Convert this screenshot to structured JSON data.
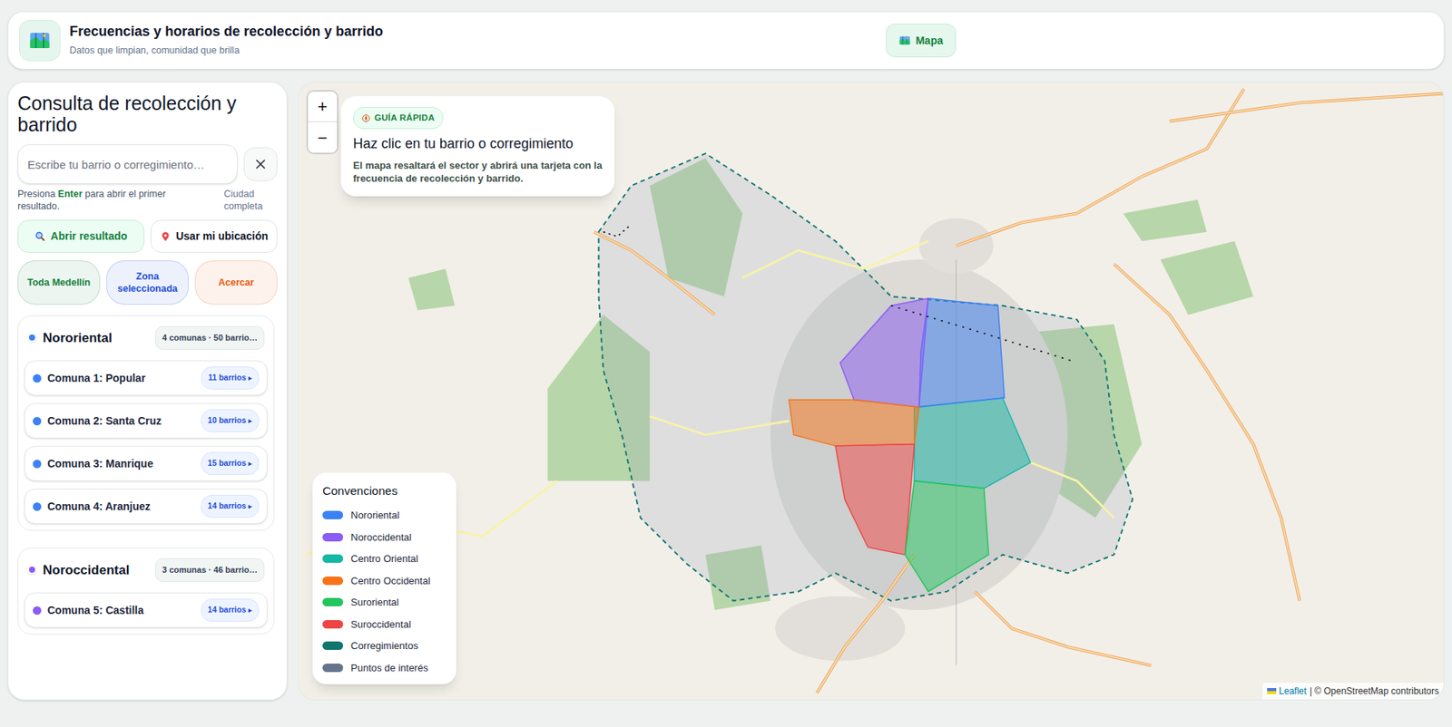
{
  "header": {
    "title": "Frecuencias y horarios de recolección y barrido",
    "subtitle": "Datos que limpian, comunidad que brilla",
    "nav": [
      {
        "label": "Mapa",
        "selected": true
      }
    ]
  },
  "sidebar": {
    "title": "Consulta de recolección y barrido",
    "search": {
      "placeholder": "Escribe tu barrio o corregimiento…",
      "value": ""
    },
    "hint": {
      "before": "Presiona ",
      "key": "Enter",
      "after": " para abrir el primer resultado."
    },
    "scope": "Ciudad completa",
    "actions": [
      "Abrir resultado",
      "Usar mi ubicación"
    ],
    "filters": [
      {
        "label": "Toda Medellín",
        "color": "#15803d"
      },
      {
        "label": "Zona seleccionada",
        "color": "#1d4ed8"
      },
      {
        "label": "Acercar",
        "color": "#ea580c"
      }
    ],
    "zones": [
      {
        "name": "Nororiental",
        "summary": "4 comunas · 50 barrio…",
        "color": "#3b82f6",
        "comunas": [
          {
            "name": "Comuna 1: Popular",
            "count": "11 barrios",
            "arrow": "▸"
          },
          {
            "name": "Comuna 2: Santa Cruz",
            "count": "10 barrios",
            "arrow": "▸"
          },
          {
            "name": "Comuna 3: Manrique",
            "count": "15 barrios",
            "arrow": "▸"
          },
          {
            "name": "Comuna 4: Aranjuez",
            "count": "14 barrios",
            "arrow": "▸"
          }
        ]
      },
      {
        "name": "Noroccidental",
        "summary": "3 comunas · 46 barrio…",
        "color": "#8b5cf6",
        "comunas": [
          {
            "name": "Comuna 5: Castilla",
            "count": "14 barrios",
            "arrow": "▸"
          }
        ]
      }
    ]
  },
  "map": {
    "zoom": [
      "+",
      "−"
    ],
    "guide": {
      "badge": "GUÍA RÁPIDA",
      "title": "Haz clic en tu barrio o corregimiento",
      "body": "El mapa resaltará el sector y abrirá una tarjeta con la frecuencia de recolección y barrido."
    },
    "legend": {
      "title": "Convenciones",
      "items": [
        {
          "label": "Nororiental",
          "color": "#3b82f6"
        },
        {
          "label": "Noroccidental",
          "color": "#8b5cf6"
        },
        {
          "label": "Centro Oriental",
          "color": "#14b8a6"
        },
        {
          "label": "Centro Occidental",
          "color": "#f97316"
        },
        {
          "label": "Suroriental",
          "color": "#22c55e"
        },
        {
          "label": "Suroccidental",
          "color": "#ef4444"
        },
        {
          "label": "Corregimientos",
          "color": "#0f766e"
        },
        {
          "label": "Puntos de interés",
          "color": "#64748b"
        }
      ]
    },
    "attribution": {
      "link": "Leaflet",
      "text": "| © OpenStreetMap contributors"
    }
  }
}
